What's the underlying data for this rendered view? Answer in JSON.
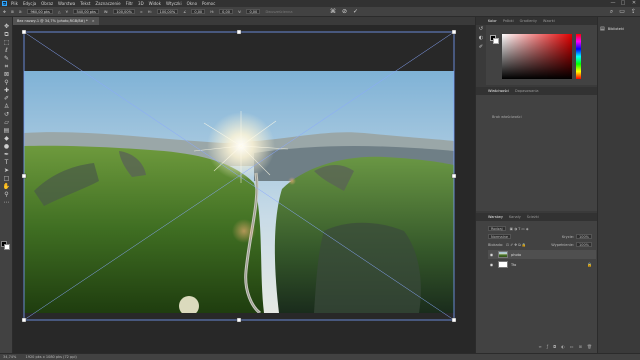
{
  "app": {
    "logo": "Ps"
  },
  "menubar": {
    "items": [
      "Plik",
      "Edycja",
      "Obraz",
      "Warstwa",
      "Tekst",
      "Zaznaczenie",
      "Filtr",
      "3D",
      "Widok",
      "Wtyczki",
      "Okno",
      "Pomoc"
    ]
  },
  "window_controls": {
    "minimize": "—",
    "maximize": "□",
    "close": "✕"
  },
  "options": {
    "x_label": "X:",
    "x_value": "960,00 pks",
    "y_label": "Y:",
    "y_value": "540,00 pks",
    "w_label": "W:",
    "w_value": "100,00%",
    "h_label": "H:",
    "h_value": "100,00%",
    "angle_label": "∠",
    "angle_value": "0,00",
    "skew_h_label": "H:",
    "skew_h_value": "0,00",
    "skew_v_label": "V:",
    "skew_v_value": "0,00",
    "interp": "Dwusześcienna"
  },
  "document": {
    "tab_title": "Bez nazwy-1 @ 34,7% (photo,RGB/8#) *",
    "close": "×"
  },
  "tools": [
    "move",
    "artboard",
    "marquee",
    "lasso",
    "quick-select",
    "crop",
    "frame",
    "eyedropper",
    "healing",
    "brush",
    "stamp",
    "history-brush",
    "eraser",
    "gradient",
    "blur",
    "dodge",
    "pen",
    "type",
    "path-select",
    "rectangle",
    "hand",
    "zoom",
    "more"
  ],
  "color_panel": {
    "tabs": [
      "Kolor",
      "Próbki",
      "Gradienty",
      "Wzorki"
    ],
    "active": 0
  },
  "properties_panel": {
    "tabs": [
      "Właściwości",
      "Dopasowania"
    ],
    "active": 0,
    "empty_text": "Brak właściwości"
  },
  "layers_panel": {
    "tabs": [
      "Warstwy",
      "Kanały",
      "Ścieżki"
    ],
    "active": 0,
    "kind_filter": "Rodzaj",
    "blend_mode": "Normalne",
    "opacity_label": "Krycie:",
    "opacity_value": "100%",
    "lock_label": "Blokada:",
    "fill_label": "Wypełnienie:",
    "fill_value": "100%",
    "layers": [
      {
        "name": "photo",
        "type": "photo",
        "selected": true
      },
      {
        "name": "Tło",
        "type": "white",
        "selected": false
      }
    ]
  },
  "right_panel": {
    "title": "Biblioteki"
  },
  "status": {
    "zoom": "34,74%",
    "dims": "1920 pks x 1080 pks (72 ppi)"
  }
}
